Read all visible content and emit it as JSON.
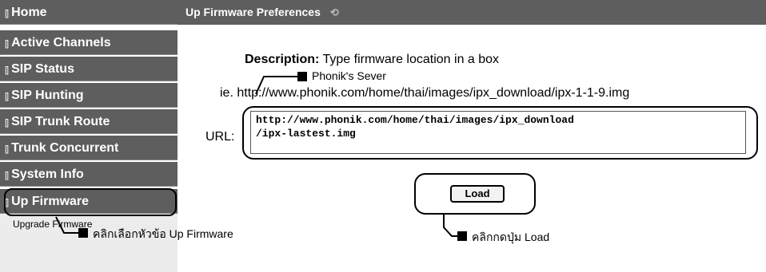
{
  "sidebar": {
    "items": [
      {
        "label": "Home"
      },
      {
        "label": "Active Channels"
      },
      {
        "label": "SIP Status"
      },
      {
        "label": "SIP Hunting"
      },
      {
        "label": "SIP Trunk Route"
      },
      {
        "label": "Trunk Concurrent"
      },
      {
        "label": "System Info"
      },
      {
        "label": "Up Firmware"
      }
    ],
    "sub_label": "Upgrade Firmware",
    "bullet_glyph": "[]"
  },
  "header": {
    "title": "Up Firmware Preferences",
    "icon": "refresh-icon"
  },
  "main": {
    "description_label": "Description:",
    "description_text": " Type firmware location in a box",
    "example_text": "ie. http://www.phonik.com/home/thai/images/ipx_download/ipx-1-1-9.img",
    "url_label": "URL:",
    "url_value": "http://www.phonik.com/home/thai/images/ipx_download\n/ipx-lastest.img",
    "load_label": "Load"
  },
  "annotations": {
    "server_callout": "Phonik's Sever",
    "menu_callout": "คลิกเลือกหัวข้อ Up Firmware",
    "load_callout": "คลิกกดปุ่ม Load"
  },
  "colors": {
    "nav_background": "#5e5e5e",
    "nav_text": "#ffffff",
    "sub_panel": "#ececec"
  }
}
